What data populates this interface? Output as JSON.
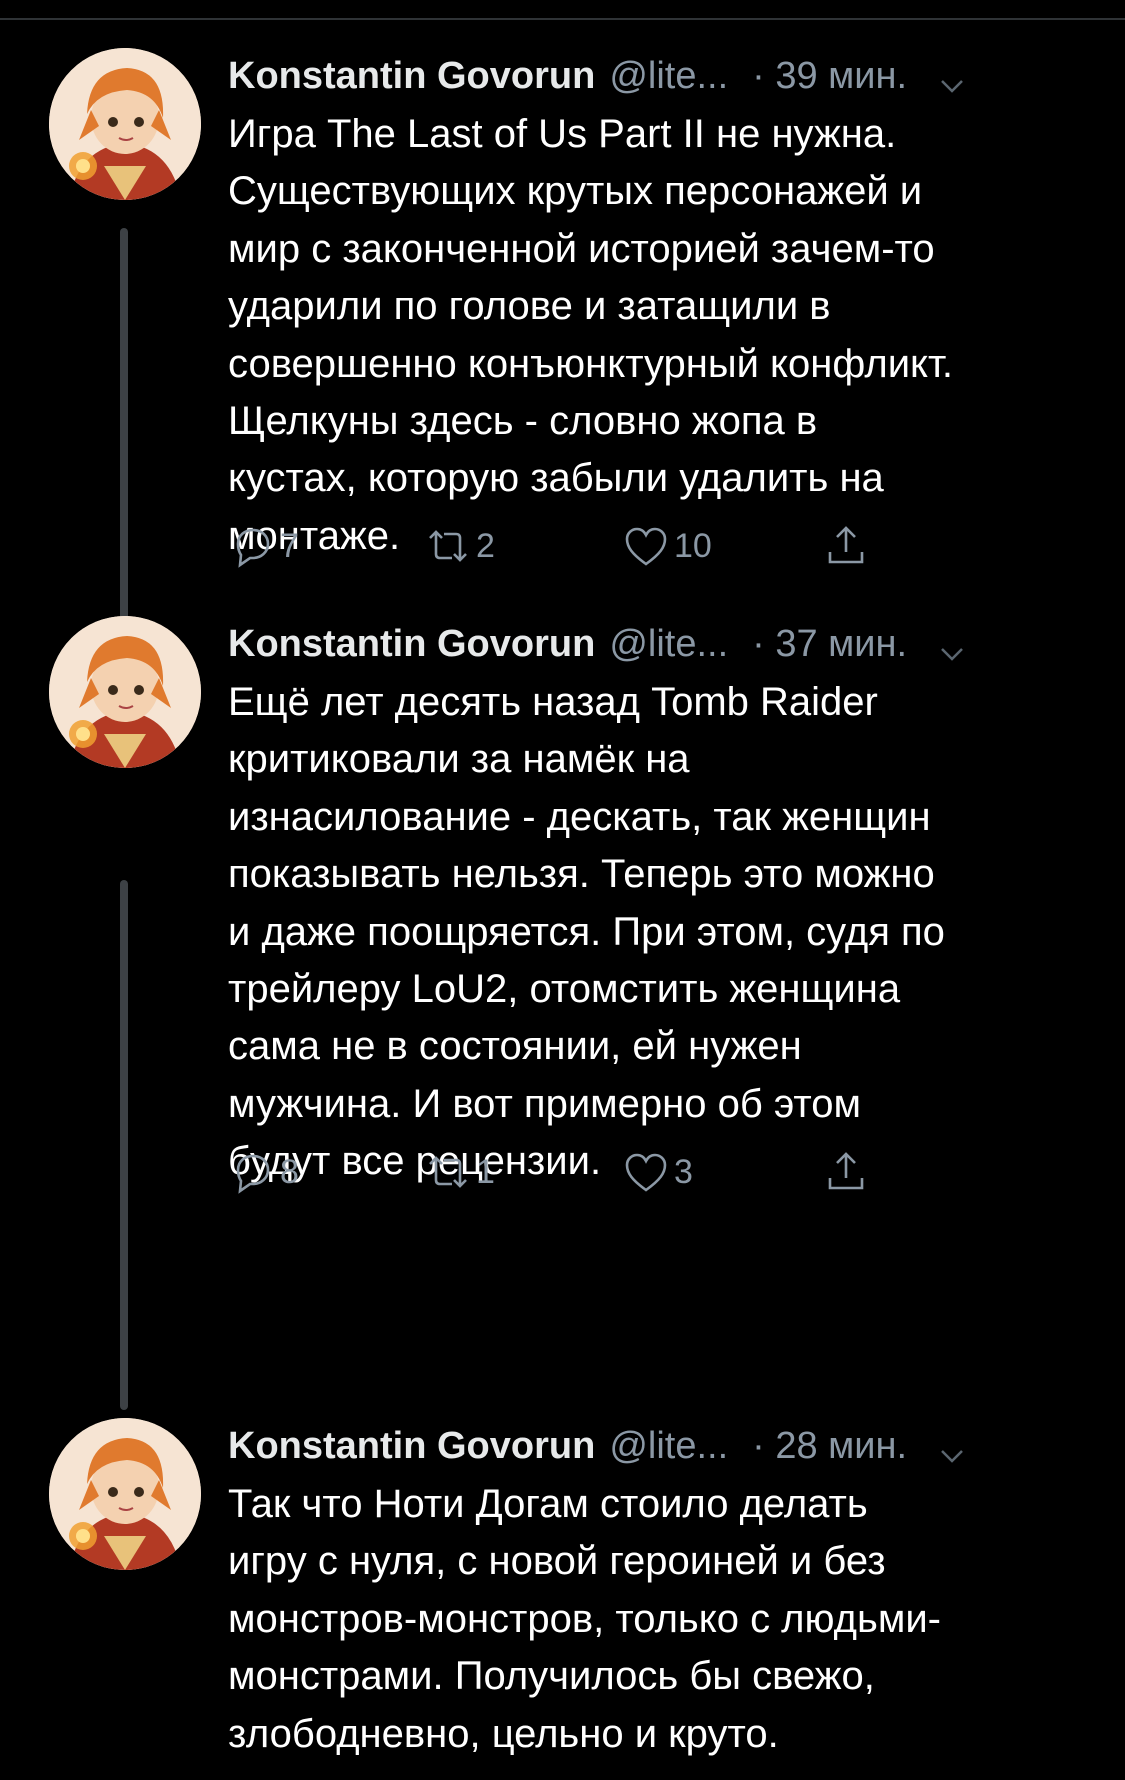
{
  "tweets": [
    {
      "author": "Konstantin Govorun",
      "handle": "@lite...",
      "time": "· 39 мин.",
      "text": "Игра The Last of Us Part II не нужна.\nСуществующих крутых персонажей и\nмир с законченной историей зачем-то\nударили по голове и затащили в\nсовершенно конъюнктурный конфликт.\nЩелкуны здесь - словно жопа в\nкустах, которую забыли удалить на\nмонтаже.",
      "replies": "7",
      "retweets": "2",
      "likes": "10"
    },
    {
      "author": "Konstantin Govorun",
      "handle": "@lite...",
      "time": "· 37 мин.",
      "text": "Ещё лет десять назад Tomb Raider\nкритиковали за намёк на\nизнасилование - дескать, так женщин\nпоказывать нельзя. Теперь это можно\nи даже поощряется. При этом, судя по\nтрейлеру LoU2, отомстить женщина\nсама не в состоянии, ей нужен\nмужчина. И вот примерно об этом\nбудут все рецензии.",
      "replies": "8",
      "retweets": "1",
      "likes": "3"
    },
    {
      "author": "Konstantin Govorun",
      "handle": "@lite...",
      "time": "· 28 мин.",
      "text": "Так что Ноти Догам стоило делать\nигру с нуля, с новой героиней и без\nмонстров-монстров, только с людьми-\nмонстрами. Получилось бы свежо,\nзлободневно, цельно и круто."
    }
  ],
  "icons": {
    "reply": "reply-icon",
    "retweet": "retweet-icon",
    "like": "heart-icon",
    "share": "share-icon",
    "menu": "chevron-down-icon"
  },
  "colors": {
    "background": "#000000",
    "text": "#ffffff",
    "secondary": "#8b98a5",
    "thread_line": "#3d4145"
  }
}
